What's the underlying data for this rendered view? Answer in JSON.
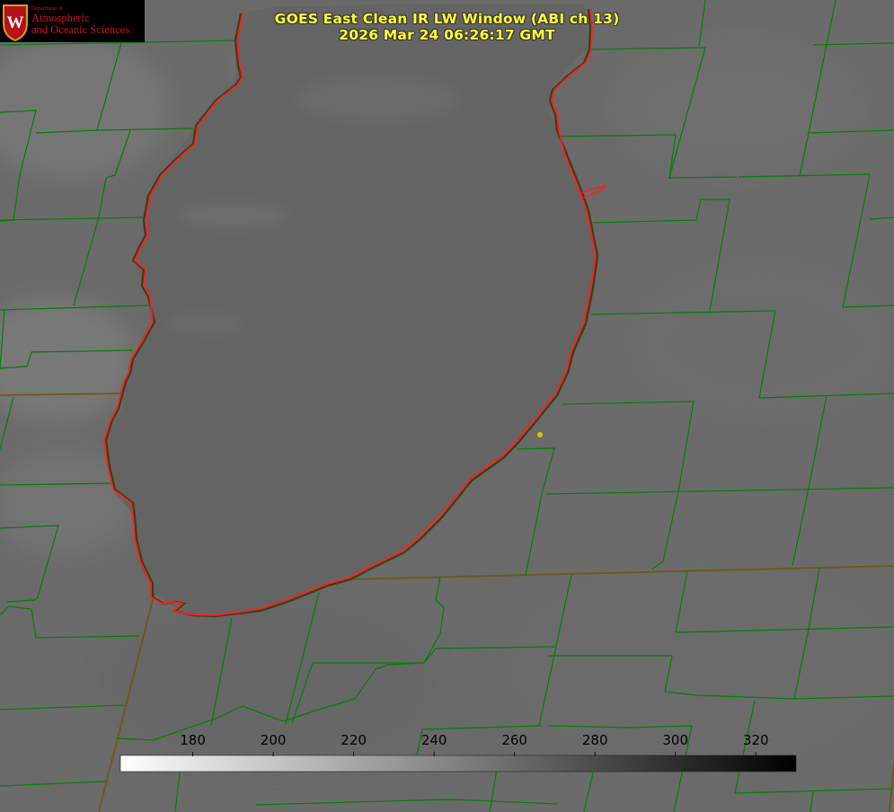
{
  "header": {
    "title_line1": "GOES East Clean IR LW Window (ABI ch 13)",
    "title_line2": "2026 Mar 24 06:26:17 GMT"
  },
  "logo": {
    "emblem_letter": "W",
    "department_label": "Department of",
    "name_line1": "Atmospheric",
    "name_line2": "and Oceanic Sciences"
  },
  "colorbar": {
    "ticks": [
      "180",
      "200",
      "220",
      "240",
      "260",
      "280",
      "300",
      "320"
    ],
    "tick_values": [
      180,
      200,
      220,
      240,
      260,
      280,
      300,
      320
    ],
    "range": [
      162,
      330
    ],
    "gradient": [
      "#ffffff",
      "#000000"
    ]
  },
  "map": {
    "boundary_color": "#008000",
    "coastline_color": "#ff2020",
    "marker_color": "#d4c600"
  }
}
